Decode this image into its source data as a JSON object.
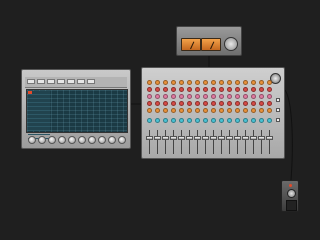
{
  "modules": {
    "vu": {
      "name": "VU meter unit"
    },
    "sequencer": {
      "title": "",
      "toolbar_buttons": 7,
      "knob_count": 10,
      "list_rows": 12
    },
    "mixer": {
      "channel_count": 16
    },
    "pedal": {
      "name": "pedal"
    }
  },
  "colors": {
    "background": "#1f1f1f",
    "vu_face": "#f3a24a",
    "sequencer_screen": "#1b3a44",
    "knob_orange": "#e8913a",
    "knob_red": "#d64a45",
    "knob_pink": "#e07aa0",
    "knob_cyan": "#49c2d4",
    "accent_red": "#e34a2a"
  },
  "icons": [
    "knob-icon",
    "fader-icon",
    "vu-meter-icon"
  ]
}
